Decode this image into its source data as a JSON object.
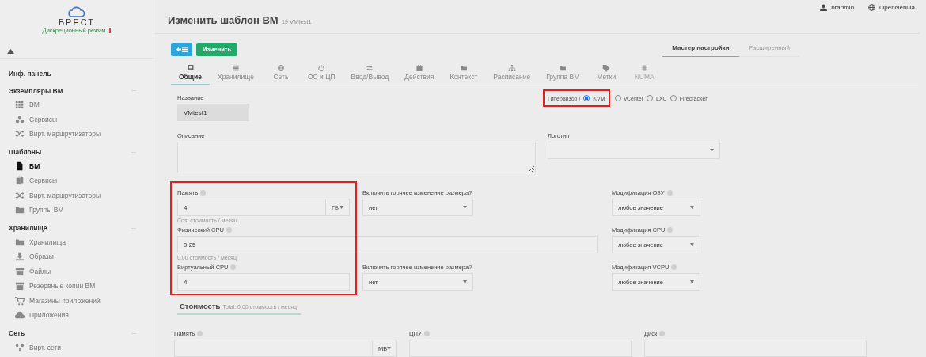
{
  "sidebar": {
    "brand": "БРЕСТ",
    "mode": "Дискреционный режим",
    "sections": [
      {
        "title": "Инф. панель"
      },
      {
        "title": "Экземпляры ВМ",
        "items": [
          {
            "label": "ВМ",
            "selected": false
          },
          {
            "label": "Сервисы",
            "selected": false
          },
          {
            "label": "Вирт. маршрутизаторы",
            "selected": false
          }
        ]
      },
      {
        "title": "Шаблоны",
        "items": [
          {
            "label": "ВМ",
            "selected": true
          },
          {
            "label": "Сервисы",
            "selected": false
          },
          {
            "label": "Вирт. маршрутизаторы",
            "selected": false
          },
          {
            "label": "Группы ВМ",
            "selected": false
          }
        ]
      },
      {
        "title": "Хранилище",
        "items": [
          {
            "label": "Хранилища",
            "selected": false
          },
          {
            "label": "Образы",
            "selected": false
          },
          {
            "label": "Файлы",
            "selected": false
          },
          {
            "label": "Резервные копии ВМ",
            "selected": false
          },
          {
            "label": "Магазины приложений",
            "selected": false
          },
          {
            "label": "Приложения",
            "selected": false
          }
        ]
      },
      {
        "title": "Сеть",
        "items": [
          {
            "label": "Вирт. сети",
            "selected": false
          }
        ]
      }
    ]
  },
  "topbar": {
    "user": "bradmin",
    "zone": "OpenNebula"
  },
  "header": {
    "title": "Изменить шаблон ВМ",
    "subtitle": "19 VMtest1"
  },
  "toolbar": {
    "submit": "Изменить"
  },
  "mode_tabs": [
    {
      "label": "Мастер настройки",
      "selected": true
    },
    {
      "label": "Расширенный",
      "selected": false
    }
  ],
  "tabs": [
    {
      "label": "Общие",
      "selected": true,
      "disabled": false
    },
    {
      "label": "Хранилище",
      "selected": false,
      "disabled": false
    },
    {
      "label": "Сеть",
      "selected": false,
      "disabled": false
    },
    {
      "label": "ОС и ЦП",
      "selected": false,
      "disabled": false
    },
    {
      "label": "Ввод/Вывод",
      "selected": false,
      "disabled": false
    },
    {
      "label": "Действия",
      "selected": false,
      "disabled": false
    },
    {
      "label": "Контекст",
      "selected": false,
      "disabled": false
    },
    {
      "label": "Расписание",
      "selected": false,
      "disabled": false
    },
    {
      "label": "Группа ВМ",
      "selected": false,
      "disabled": false
    },
    {
      "label": "Метки",
      "selected": false,
      "disabled": false
    },
    {
      "label": "NUMA",
      "selected": false,
      "disabled": true
    }
  ],
  "general": {
    "name": {
      "label": "Название",
      "value": "VMtest1"
    },
    "hypervisor": {
      "label": "Гипервизор /",
      "highlighted": true,
      "options": [
        {
          "label": "KVM",
          "selected": true
        },
        {
          "label": "vCenter",
          "selected": false
        },
        {
          "label": "LXC",
          "selected": false
        },
        {
          "label": "Firecracker",
          "selected": false
        }
      ]
    },
    "description": {
      "label": "Описание"
    },
    "logo": {
      "label": "Логотип"
    },
    "capacity": {
      "highlighted": true,
      "memory": {
        "label": "Память",
        "value": "4",
        "unit": "ГБ",
        "cost": "Cost",
        "cost_unit": "стоимость / месяц"
      },
      "physical_cpu": {
        "label": "Физический CPU",
        "value": "0,25",
        "cost": "0.00",
        "cost_unit": "стоимость / месяц"
      },
      "virtual_cpu": {
        "label": "Виртуальный CPU",
        "value": "4"
      }
    },
    "hot_resize": [
      {
        "label": "Включить горячее изменение размера?",
        "value": "нет"
      },
      {
        "label": "Включить горячее изменение размера?",
        "value": "нет"
      }
    ],
    "modifications": [
      {
        "label": "Модификация ОЗУ",
        "value": "любое значение"
      },
      {
        "label": "Модификация CPU",
        "value": "любое значение"
      },
      {
        "label": "Модификация VCPU",
        "value": "любое значение"
      }
    ]
  },
  "cost": {
    "title": "Стоимость",
    "total": "Total: 0.00",
    "unit": "стоимость / месяц",
    "fields": [
      {
        "label": "Память",
        "unit": "МБ"
      },
      {
        "label": "ЦПУ"
      },
      {
        "label": "Диск"
      }
    ]
  }
}
